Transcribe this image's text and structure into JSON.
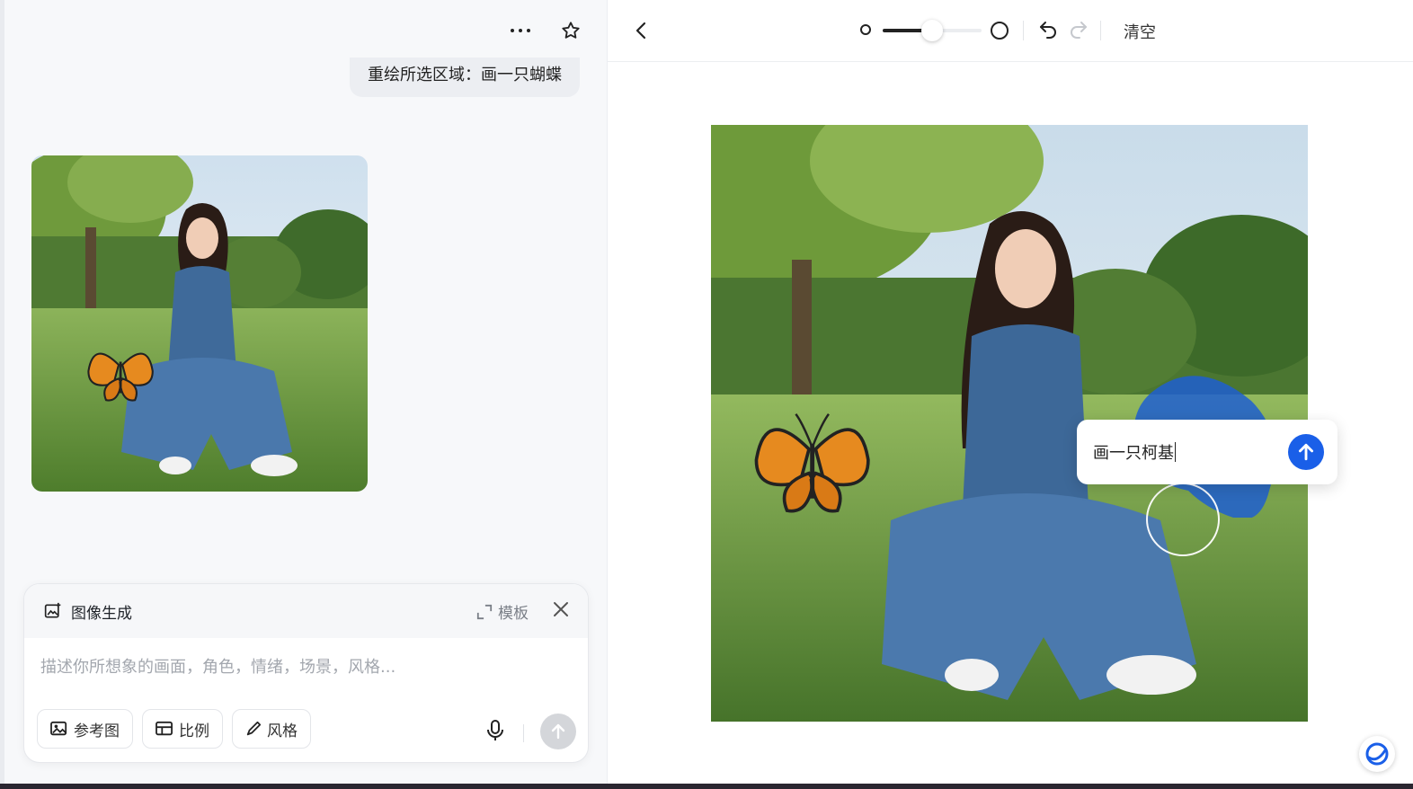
{
  "chat": {
    "user_message": "重绘所选区域：画一只蝴蝶"
  },
  "composer": {
    "mode_title": "图像生成",
    "template_label": "模板",
    "prompt_placeholder": "描述你所想象的画面，角色，情绪，场景，风格...",
    "chips": {
      "reference": "参考图",
      "ratio": "比例",
      "style": "风格"
    }
  },
  "editor": {
    "brush_size": 0.5,
    "clear_label": "清空",
    "inpaint_text": "画一只柯基",
    "mask_color": "#1f5fd0",
    "accent": "#1a5fe8"
  },
  "icons": [
    "more-icon",
    "star-icon",
    "image-gen-icon",
    "expand-icon",
    "close-icon",
    "image-icon",
    "ratio-icon",
    "brush-icon",
    "mic-icon",
    "arrow-up-icon",
    "back-icon",
    "undo-icon",
    "redo-icon",
    "assistant-icon"
  ]
}
